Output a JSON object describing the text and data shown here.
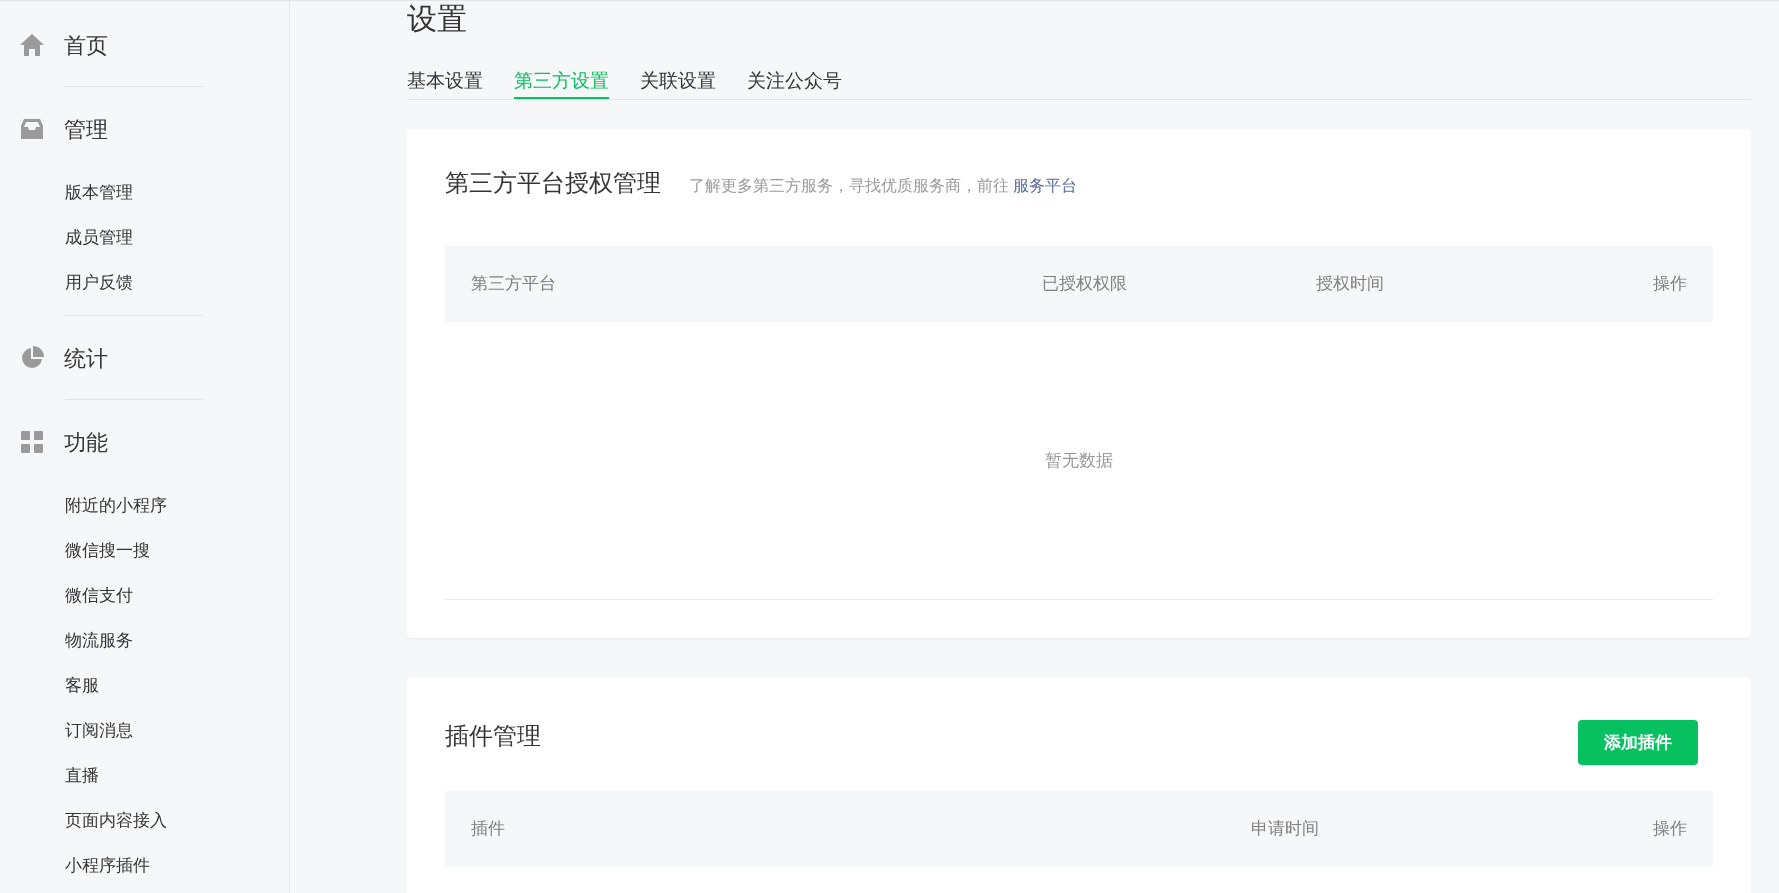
{
  "sidebar": {
    "groups": [
      {
        "label": "首页",
        "kind": "home"
      },
      {
        "label": "管理",
        "kind": "inbox",
        "items": [
          "版本管理",
          "成员管理",
          "用户反馈"
        ]
      },
      {
        "label": "统计",
        "kind": "pie"
      },
      {
        "label": "功能",
        "kind": "grid",
        "items": [
          "附近的小程序",
          "微信搜一搜",
          "微信支付",
          "物流服务",
          "客服",
          "订阅消息",
          "直播",
          "页面内容接入",
          "小程序插件"
        ]
      }
    ]
  },
  "page": {
    "title": "设置"
  },
  "tabs": [
    {
      "label": "基本设置",
      "selected": false
    },
    {
      "label": "第三方设置",
      "selected": true
    },
    {
      "label": "关联设置",
      "selected": false
    },
    {
      "label": "关注公众号",
      "selected": false
    }
  ],
  "authorization": {
    "title": "第三方平台授权管理",
    "hint": "了解更多第三方服务，寻找优质服务商，前往",
    "link": "服务平台",
    "columns": [
      "第三方平台",
      "已授权权限",
      "授权时间",
      "操作"
    ],
    "empty": "暂无数据"
  },
  "plugins": {
    "title": "插件管理",
    "button": "添加插件",
    "columns": [
      "插件",
      "申请时间",
      "操作"
    ]
  }
}
